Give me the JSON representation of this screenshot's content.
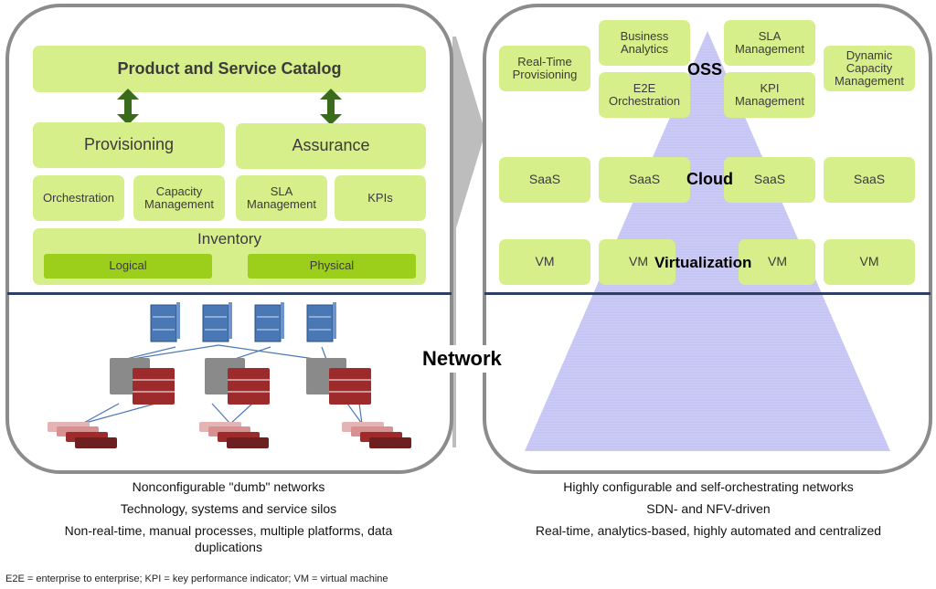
{
  "left_panel": {
    "catalog": "Product and Service Catalog",
    "provisioning": "Provisioning",
    "assurance": "Assurance",
    "sub_boxes": [
      "Orchestration",
      "Capacity Management",
      "SLA Management",
      "KPIs"
    ],
    "inventory": "Inventory",
    "inventory_items": [
      "Logical",
      "Physical"
    ]
  },
  "center_label": "Network",
  "right_panel": {
    "oss_label": "OSS",
    "oss_boxes": [
      "Real-Time Provisioning",
      "Business Analytics",
      "E2E Orchestration",
      "SLA Management",
      "KPI Management",
      "Dynamic Capacity Management"
    ],
    "cloud_label": "Cloud",
    "cloud_boxes": [
      "SaaS",
      "SaaS",
      "SaaS",
      "SaaS"
    ],
    "virtualization_label": "Virtualization",
    "vm_boxes": [
      "VM",
      "VM",
      "VM",
      "VM"
    ]
  },
  "left_captions": [
    "Nonconfigurable \"dumb\" networks",
    "Technology, systems and service silos",
    "Non-real-time, manual processes, multiple platforms, data duplications"
  ],
  "right_captions": [
    "Highly configurable and self-orchestrating networks",
    "SDN- and NFV-driven",
    "Real-time, analytics-based, highly automated and centralized"
  ],
  "footnote": "E2E = enterprise to enterprise; KPI = key performance indicator; VM = virtual machine",
  "colors": {
    "box_green": "#d7ef8a",
    "dark_green": "#9ccf1c",
    "arrow_green": "#3a6b1a",
    "pyramid": "#c9c9f4",
    "divider": "#2e3f63",
    "server_blue": "#4a78b5",
    "switch_gray": "#8a8a8a",
    "switch_red": "#9e2b2b"
  }
}
